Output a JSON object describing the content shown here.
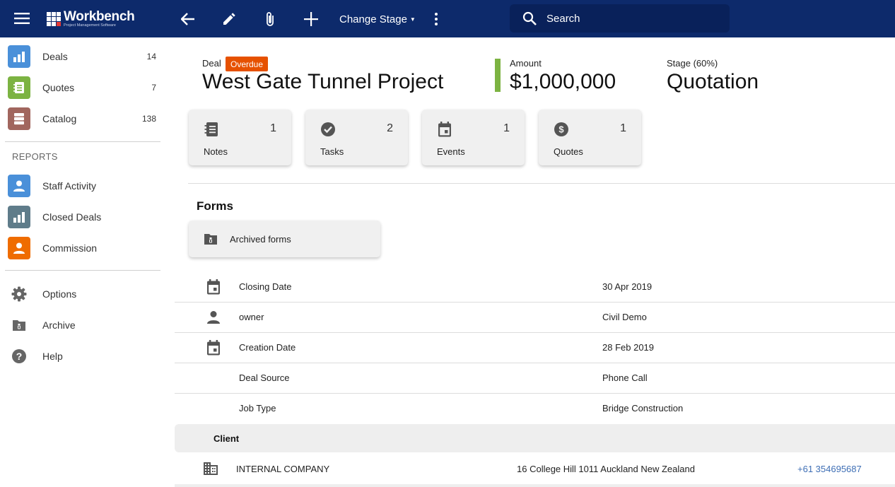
{
  "colors": {
    "topbar": "#0d2a6b",
    "search_bg": "#09215a",
    "overdue": "#e65100",
    "amount_accent": "#7cb342",
    "deals_icon": "#4a90d9",
    "quotes_icon": "#7cb342",
    "catalog_icon": "#a1665e",
    "staff_activity_icon": "#4a90d9",
    "closed_deals_icon": "#5f7c8a",
    "commission_icon": "#ef6c00",
    "link": "#3f6fb5"
  },
  "topbar": {
    "logo_name": "Workbench",
    "logo_tagline": "Project Management Software",
    "icons": [
      "menu-icon",
      "arrow-back-icon",
      "pencil-icon",
      "paperclip-icon",
      "plus-icon",
      "more-vert-icon",
      "search-icon"
    ],
    "change_stage_label": "Change Stage",
    "search_placeholder": "Search"
  },
  "sidebar": {
    "items": [
      {
        "label": "Deals",
        "count": "14",
        "icon": "bar-chart-icon"
      },
      {
        "label": "Quotes",
        "count": "7",
        "icon": "notebook-icon"
      },
      {
        "label": "Catalog",
        "count": "138",
        "icon": "catalog-icon"
      }
    ],
    "reports_heading": "REPORTS",
    "reports": [
      {
        "label": "Staff Activity",
        "icon": "person-icon"
      },
      {
        "label": "Closed Deals",
        "icon": "bar-chart-icon"
      },
      {
        "label": "Commission",
        "icon": "person-icon"
      }
    ],
    "footer_items": [
      {
        "label": "Options",
        "icon": "gear-icon"
      },
      {
        "label": "Archive",
        "icon": "archive-folder-icon"
      },
      {
        "label": "Help",
        "icon": "help-icon"
      }
    ]
  },
  "deal": {
    "type_label": "Deal",
    "status_badge": "Overdue",
    "title": "West Gate Tunnel Project",
    "amount_label": "Amount",
    "amount_value": "$1,000,000",
    "stage_label": "Stage (60%)",
    "stage_value": "Quotation"
  },
  "tiles": [
    {
      "label": "Notes",
      "count": "1",
      "icon": "notebook-icon"
    },
    {
      "label": "Tasks",
      "count": "2",
      "icon": "check-circle-icon"
    },
    {
      "label": "Events",
      "count": "1",
      "icon": "calendar-icon"
    },
    {
      "label": "Quotes",
      "count": "1",
      "icon": "dollar-circle-icon"
    }
  ],
  "forms": {
    "title": "Forms",
    "archived_label": "Archived forms"
  },
  "details": [
    {
      "label": "Closing Date",
      "value": "30 Apr 2019",
      "icon": "calendar-icon"
    },
    {
      "label": "owner",
      "value": "Civil Demo",
      "icon": "person-icon"
    },
    {
      "label": "Creation Date",
      "value": "28 Feb 2019",
      "icon": "calendar-icon"
    },
    {
      "label": "Deal Source",
      "value": "Phone Call",
      "icon": ""
    },
    {
      "label": "Job Type",
      "value": "Bridge Construction",
      "icon": ""
    }
  ],
  "client": {
    "heading": "Client",
    "name": "INTERNAL COMPANY",
    "address": "16 College Hill 1011 Auckland New Zealand",
    "phone": "+61 354695687",
    "icon": "building-icon"
  }
}
